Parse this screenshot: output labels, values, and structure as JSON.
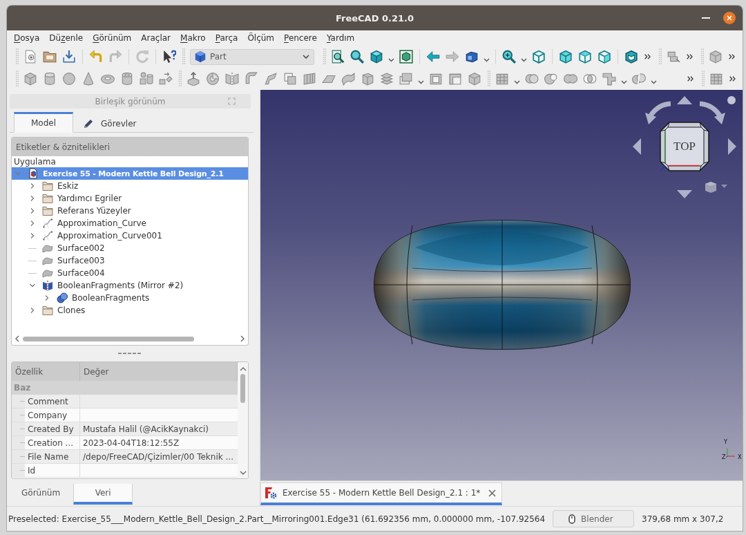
{
  "window": {
    "title": "FreeCAD 0.21.0"
  },
  "menu": [
    {
      "key": "D",
      "post": "osya"
    },
    {
      "pre": "Dü",
      "key": "z",
      "post": "enle"
    },
    {
      "key": "G",
      "post": "örünüm"
    },
    {
      "pre": "Araçlar"
    },
    {
      "key": "M",
      "post": "akro"
    },
    {
      "key": "P",
      "post": "arça"
    },
    {
      "pre": "Ölçüm"
    },
    {
      "key": "P",
      "post": "encere"
    },
    {
      "key": "Y",
      "post": "ardım"
    }
  ],
  "toolbar": {
    "workbench": "Part"
  },
  "combo_view": {
    "title": "Birleşik görünüm",
    "tabs": [
      {
        "label": "Model",
        "selected": true
      },
      {
        "label": "Görevler",
        "selected": false
      }
    ],
    "tree": {
      "column": "Etiketler & öznitelikleri",
      "root": "Uygulama",
      "items": [
        {
          "label": "Exercise 55 - Modern Kettle Bell Design_2.1",
          "kind": "document",
          "expanded": true,
          "selected": true,
          "children": [
            {
              "label": "Eskiz",
              "kind": "folder",
              "expanded": false,
              "selected": false
            },
            {
              "label": "Yardımcı Egriler",
              "kind": "folder",
              "expanded": false,
              "selected": false
            },
            {
              "label": "Referans Yüzeyler",
              "kind": "folder",
              "expanded": false,
              "selected": false
            },
            {
              "label": "Approximation_Curve",
              "kind": "curve",
              "expanded": false,
              "selected": false
            },
            {
              "label": "Approximation_Curve001",
              "kind": "curve",
              "expanded": false,
              "selected": false
            },
            {
              "label": "Surface002",
              "kind": "surface",
              "selected": false
            },
            {
              "label": "Surface003",
              "kind": "surface",
              "selected": false
            },
            {
              "label": "Surface004",
              "kind": "surface",
              "selected": false
            },
            {
              "label": "BooleanFragments (Mirror #2)",
              "kind": "mirror",
              "expanded": true,
              "selected": false,
              "children": [
                {
                  "label": "BooleanFragments",
                  "kind": "boolean",
                  "expanded": false,
                  "selected": false
                }
              ]
            },
            {
              "label": "Clones",
              "kind": "folder",
              "expanded": false,
              "selected": false
            }
          ]
        }
      ]
    },
    "properties": {
      "columns": [
        "Özellik",
        "Değer"
      ],
      "groups": [
        {
          "name": "Baz",
          "rows": [
            {
              "name": "Comment"
            },
            {
              "name": "Company"
            },
            {
              "name": "Created By",
              "value": "Mustafa Halil (@AcikKaynakci)"
            },
            {
              "name": "Creation ...",
              "value": "2023-04-04T18:12:55Z"
            },
            {
              "name": "File Name",
              "value": "/depo/FreeCAD/Çizimler/00 Teknik ..."
            },
            {
              "name": "Id"
            }
          ]
        }
      ]
    },
    "bottom_tabs": [
      {
        "label": "Görünüm",
        "selected": false
      },
      {
        "label": "Veri",
        "selected": true
      }
    ]
  },
  "viewport": {
    "nav_cube_face": "TOP",
    "axis_labels": [
      "Y",
      "Z",
      "X"
    ]
  },
  "document_tabs": [
    {
      "label": "Exercise 55 - Modern Kettle Bell Design_2.1 : 1*",
      "selected": true
    }
  ],
  "status_bar": {
    "message": "Preselected: Exercise_55___Modern_Kettle_Bell_Design_2.Part__Mirroring001.Edge31 (61.692356 mm, 0.000000 mm, -107.92564",
    "navigation_style": "Blender",
    "dimensions": "379,68 mm x 307,2"
  }
}
